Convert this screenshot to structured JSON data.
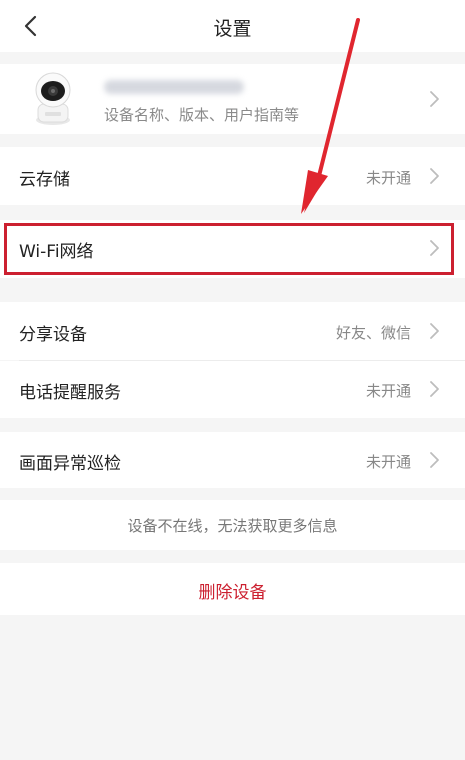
{
  "header": {
    "title": "设置"
  },
  "device": {
    "subtitle": "设备名称、版本、用户指南等"
  },
  "rows": {
    "cloud": {
      "label": "云存储",
      "value": "未开通"
    },
    "wifi": {
      "label": "Wi-Fi网络"
    },
    "share": {
      "label": "分享设备",
      "value": "好友、微信"
    },
    "phone": {
      "label": "电话提醒服务",
      "value": "未开通"
    },
    "patrol": {
      "label": "画面异常巡检",
      "value": "未开通"
    }
  },
  "info": "设备不在线，无法获取更多信息",
  "delete_label": "删除设备",
  "colors": {
    "accent_red": "#cc2030",
    "chevron": "#bdbdbd"
  },
  "icons": [
    "back-icon",
    "chevron-right-icon",
    "camera-device-image",
    "annotation-arrow"
  ]
}
